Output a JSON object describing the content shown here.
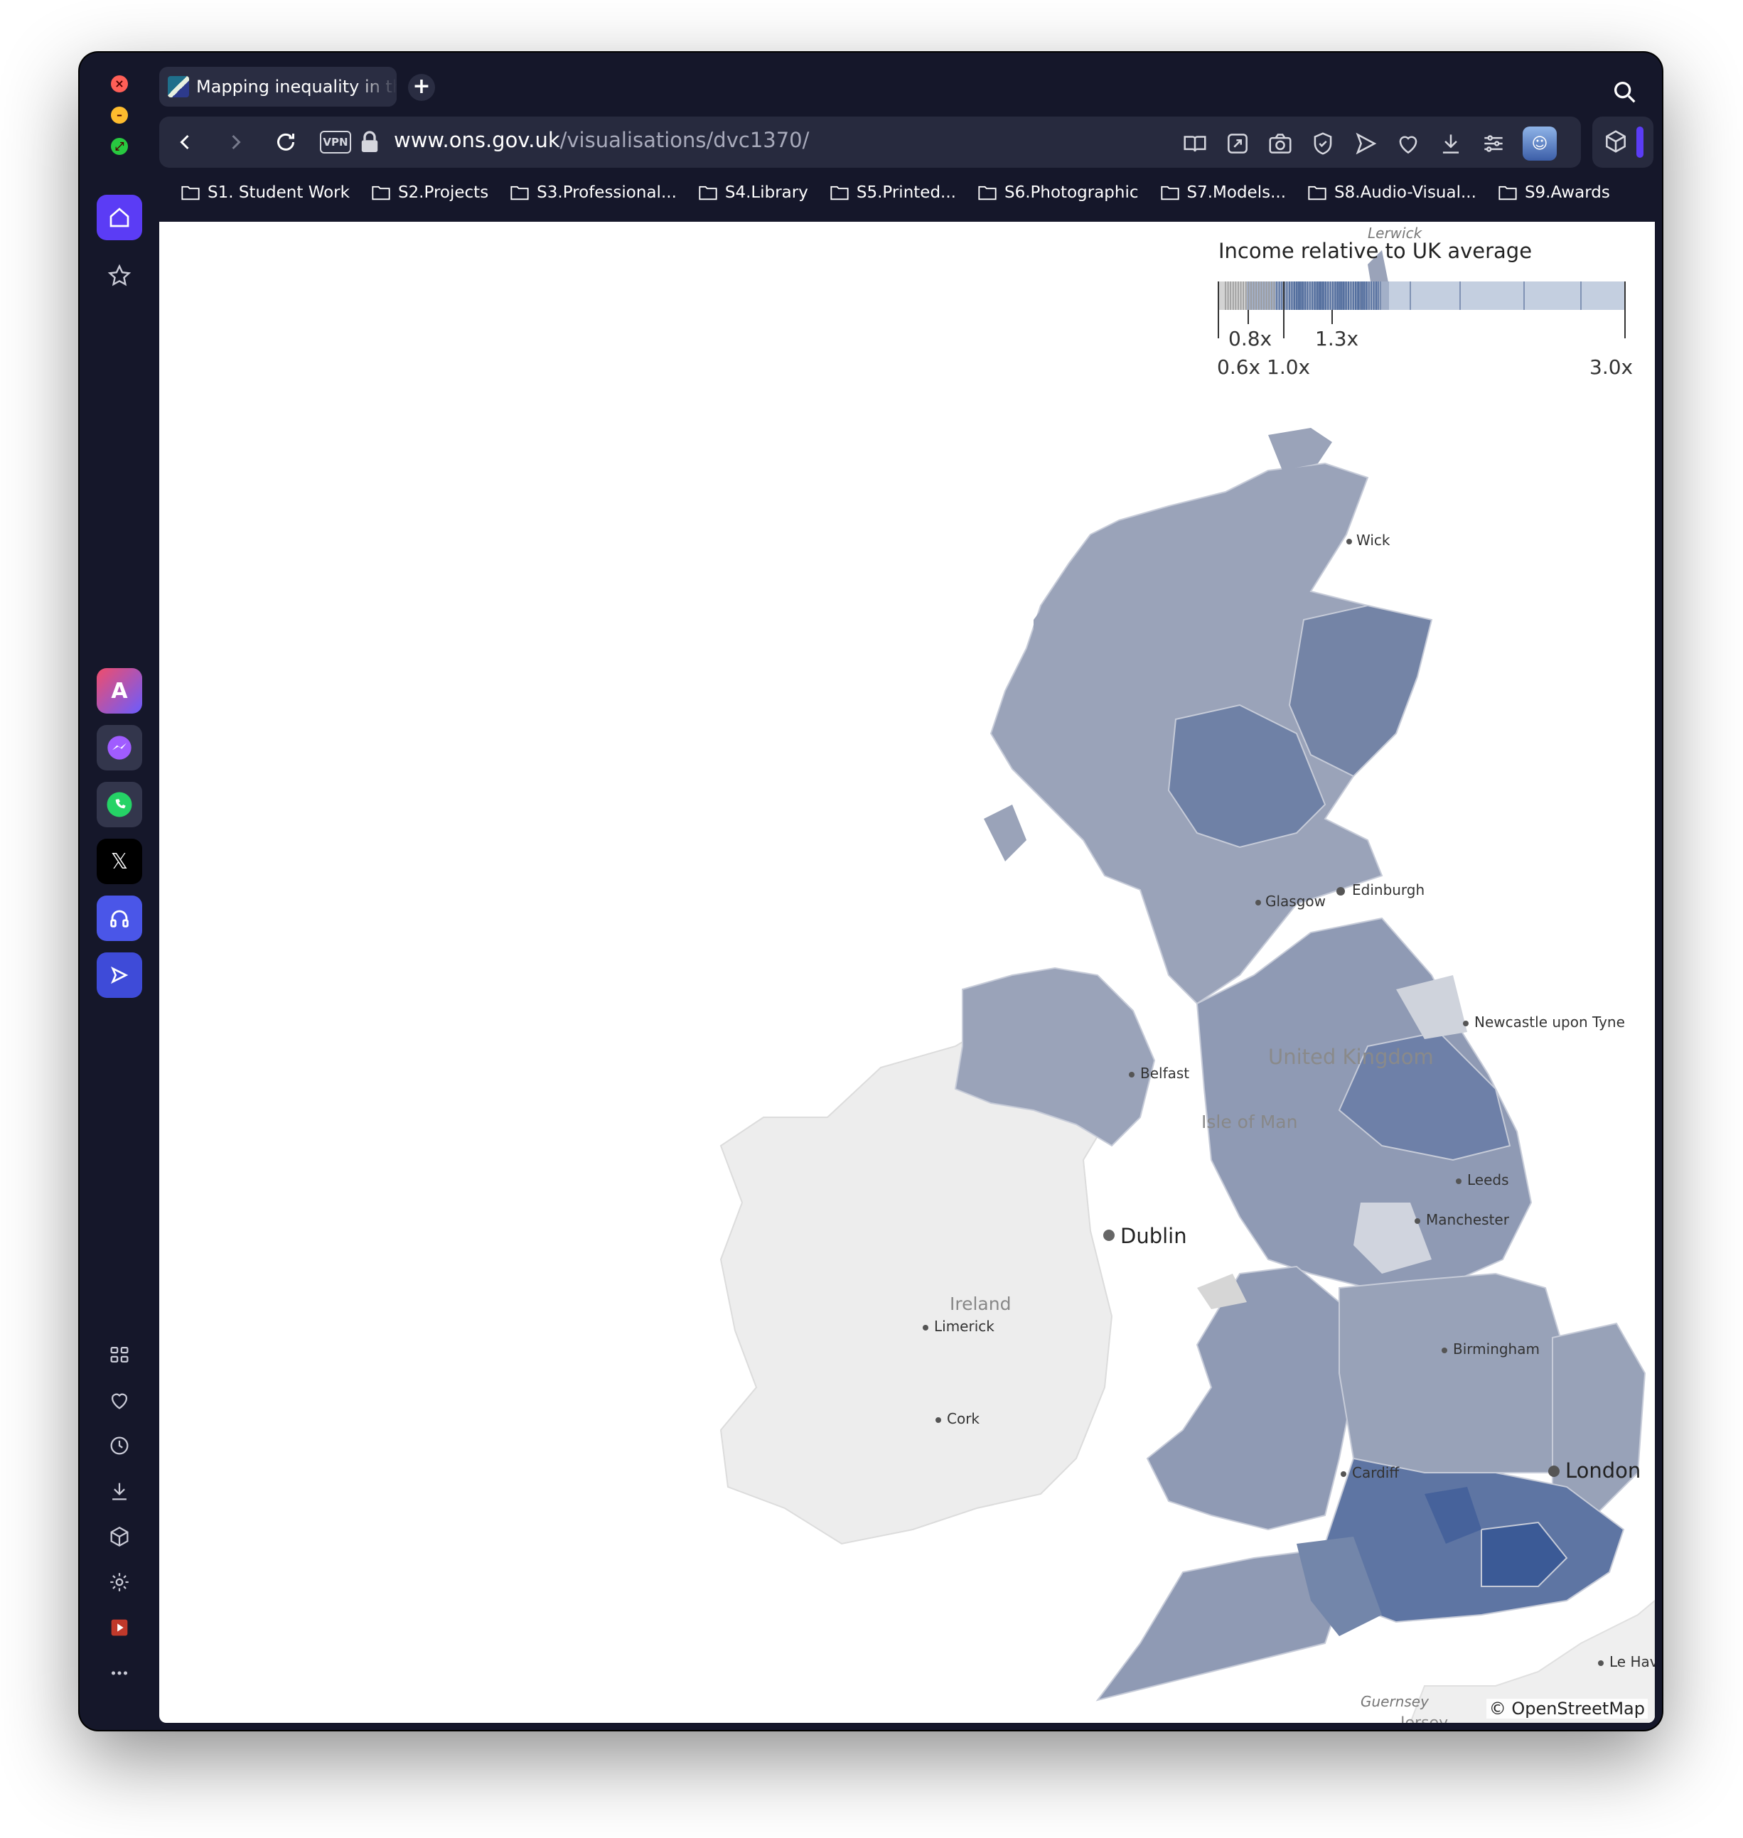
{
  "window": {
    "tab": {
      "title": "Mapping inequality in the"
    },
    "address": {
      "host": "www.ons.gov.uk",
      "path": "/visualisations/dvc1370/"
    },
    "bookmarks": [
      "S1. Student Work",
      "S2.Projects",
      "S3.Professional...",
      "S4.Library",
      "S5.Printed...",
      "S6.Photographic",
      "S7.Models...",
      "S8.Audio-Visual...",
      "S9.Awards"
    ]
  },
  "legend": {
    "title": "Income relative to UK average",
    "ticks_upper": [
      "0.8x",
      "1.3x"
    ],
    "ticks_lower": [
      "0.6x",
      "1.0x",
      "3.0x"
    ],
    "tick_values": {
      "0.6x": 0.6,
      "0.8x": 0.8,
      "1.0x": 1.0,
      "1.3x": 1.3,
      "3.0x": 3.0
    },
    "colors": {
      "low": "#d8d8d8",
      "mid": "#9ba5bb",
      "high": "#3a5a94"
    }
  },
  "map": {
    "labels": {
      "lerwick": "Lerwick",
      "wick": "Wick",
      "edinburgh": "Edinburgh",
      "glasgow": "Glasgow",
      "newcastle": "Newcastle upon Tyne",
      "united_kingdom": "United Kingdom",
      "belfast": "Belfast",
      "isle_of_man": "Isle of Man",
      "leeds": "Leeds",
      "manchester": "Manchester",
      "dublin": "Dublin",
      "ireland": "Ireland",
      "limerick": "Limerick",
      "birmingham": "Birmingham",
      "cork": "Cork",
      "cardiff": "Cardiff",
      "london": "London",
      "guernsey": "Guernsey",
      "jersey": "Jersey",
      "le_havre": "Le Havre"
    },
    "attribution": "© OpenStreetMap"
  }
}
